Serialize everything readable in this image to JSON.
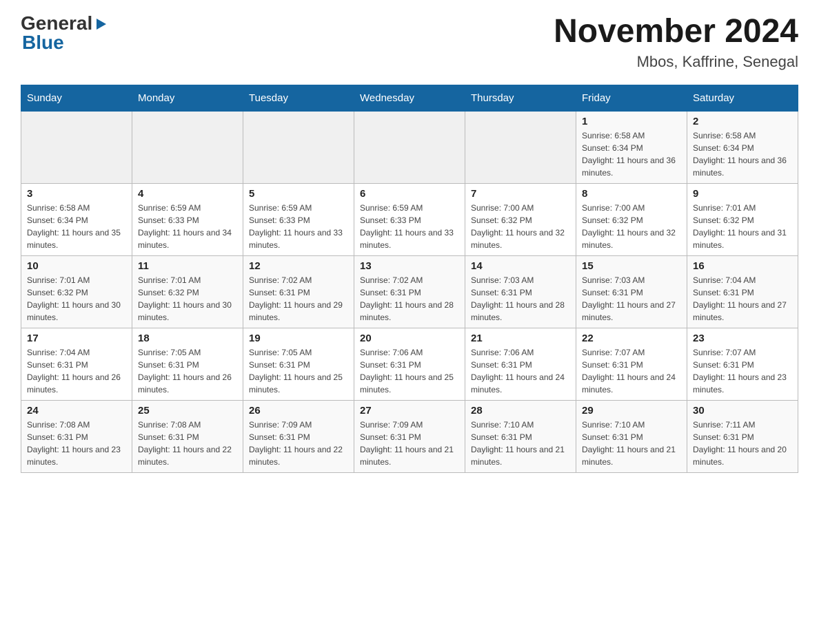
{
  "header": {
    "logo_general": "General",
    "logo_blue": "Blue",
    "title": "November 2024",
    "subtitle": "Mbos, Kaffrine, Senegal"
  },
  "days_of_week": [
    "Sunday",
    "Monday",
    "Tuesday",
    "Wednesday",
    "Thursday",
    "Friday",
    "Saturday"
  ],
  "weeks": [
    [
      {
        "day": "",
        "info": ""
      },
      {
        "day": "",
        "info": ""
      },
      {
        "day": "",
        "info": ""
      },
      {
        "day": "",
        "info": ""
      },
      {
        "day": "",
        "info": ""
      },
      {
        "day": "1",
        "info": "Sunrise: 6:58 AM\nSunset: 6:34 PM\nDaylight: 11 hours and 36 minutes."
      },
      {
        "day": "2",
        "info": "Sunrise: 6:58 AM\nSunset: 6:34 PM\nDaylight: 11 hours and 36 minutes."
      }
    ],
    [
      {
        "day": "3",
        "info": "Sunrise: 6:58 AM\nSunset: 6:34 PM\nDaylight: 11 hours and 35 minutes."
      },
      {
        "day": "4",
        "info": "Sunrise: 6:59 AM\nSunset: 6:33 PM\nDaylight: 11 hours and 34 minutes."
      },
      {
        "day": "5",
        "info": "Sunrise: 6:59 AM\nSunset: 6:33 PM\nDaylight: 11 hours and 33 minutes."
      },
      {
        "day": "6",
        "info": "Sunrise: 6:59 AM\nSunset: 6:33 PM\nDaylight: 11 hours and 33 minutes."
      },
      {
        "day": "7",
        "info": "Sunrise: 7:00 AM\nSunset: 6:32 PM\nDaylight: 11 hours and 32 minutes."
      },
      {
        "day": "8",
        "info": "Sunrise: 7:00 AM\nSunset: 6:32 PM\nDaylight: 11 hours and 32 minutes."
      },
      {
        "day": "9",
        "info": "Sunrise: 7:01 AM\nSunset: 6:32 PM\nDaylight: 11 hours and 31 minutes."
      }
    ],
    [
      {
        "day": "10",
        "info": "Sunrise: 7:01 AM\nSunset: 6:32 PM\nDaylight: 11 hours and 30 minutes."
      },
      {
        "day": "11",
        "info": "Sunrise: 7:01 AM\nSunset: 6:32 PM\nDaylight: 11 hours and 30 minutes."
      },
      {
        "day": "12",
        "info": "Sunrise: 7:02 AM\nSunset: 6:31 PM\nDaylight: 11 hours and 29 minutes."
      },
      {
        "day": "13",
        "info": "Sunrise: 7:02 AM\nSunset: 6:31 PM\nDaylight: 11 hours and 28 minutes."
      },
      {
        "day": "14",
        "info": "Sunrise: 7:03 AM\nSunset: 6:31 PM\nDaylight: 11 hours and 28 minutes."
      },
      {
        "day": "15",
        "info": "Sunrise: 7:03 AM\nSunset: 6:31 PM\nDaylight: 11 hours and 27 minutes."
      },
      {
        "day": "16",
        "info": "Sunrise: 7:04 AM\nSunset: 6:31 PM\nDaylight: 11 hours and 27 minutes."
      }
    ],
    [
      {
        "day": "17",
        "info": "Sunrise: 7:04 AM\nSunset: 6:31 PM\nDaylight: 11 hours and 26 minutes."
      },
      {
        "day": "18",
        "info": "Sunrise: 7:05 AM\nSunset: 6:31 PM\nDaylight: 11 hours and 26 minutes."
      },
      {
        "day": "19",
        "info": "Sunrise: 7:05 AM\nSunset: 6:31 PM\nDaylight: 11 hours and 25 minutes."
      },
      {
        "day": "20",
        "info": "Sunrise: 7:06 AM\nSunset: 6:31 PM\nDaylight: 11 hours and 25 minutes."
      },
      {
        "day": "21",
        "info": "Sunrise: 7:06 AM\nSunset: 6:31 PM\nDaylight: 11 hours and 24 minutes."
      },
      {
        "day": "22",
        "info": "Sunrise: 7:07 AM\nSunset: 6:31 PM\nDaylight: 11 hours and 24 minutes."
      },
      {
        "day": "23",
        "info": "Sunrise: 7:07 AM\nSunset: 6:31 PM\nDaylight: 11 hours and 23 minutes."
      }
    ],
    [
      {
        "day": "24",
        "info": "Sunrise: 7:08 AM\nSunset: 6:31 PM\nDaylight: 11 hours and 23 minutes."
      },
      {
        "day": "25",
        "info": "Sunrise: 7:08 AM\nSunset: 6:31 PM\nDaylight: 11 hours and 22 minutes."
      },
      {
        "day": "26",
        "info": "Sunrise: 7:09 AM\nSunset: 6:31 PM\nDaylight: 11 hours and 22 minutes."
      },
      {
        "day": "27",
        "info": "Sunrise: 7:09 AM\nSunset: 6:31 PM\nDaylight: 11 hours and 21 minutes."
      },
      {
        "day": "28",
        "info": "Sunrise: 7:10 AM\nSunset: 6:31 PM\nDaylight: 11 hours and 21 minutes."
      },
      {
        "day": "29",
        "info": "Sunrise: 7:10 AM\nSunset: 6:31 PM\nDaylight: 11 hours and 21 minutes."
      },
      {
        "day": "30",
        "info": "Sunrise: 7:11 AM\nSunset: 6:31 PM\nDaylight: 11 hours and 20 minutes."
      }
    ]
  ]
}
